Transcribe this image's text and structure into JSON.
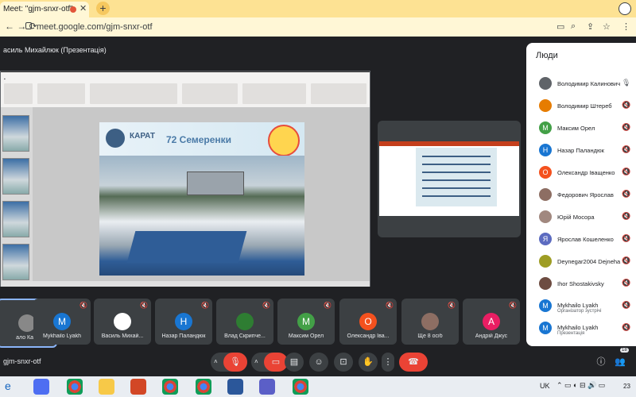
{
  "browser": {
    "tab_title": "Meet: \"gjm-snxr-otf\"",
    "close_glyph": "✕",
    "new_tab_glyph": "+",
    "url": "meet.google.com/gjm-snxr-otf",
    "nav_back": "←  →  ⟳"
  },
  "meet": {
    "presenter_label": "асиль Михайлюк (Презентація)",
    "meeting_code": "gjm-snxr-otf",
    "people_panel_title": "Люди",
    "accent": "#1a73e8",
    "hangup_color": "#ea4335"
  },
  "slide": {
    "logo_text": "КАРАТ",
    "title": "72 Семеренки"
  },
  "people": [
    {
      "name": "Володимир Калинович",
      "initial": "",
      "color": "#5f6368",
      "sub": "",
      "mic": "🎙"
    },
    {
      "name": "Володимир Штереб",
      "initial": "",
      "color": "#e67c00",
      "sub": "",
      "mic": "🔇"
    },
    {
      "name": "Максим Орел",
      "initial": "M",
      "color": "#43a047",
      "sub": "",
      "mic": "🔇"
    },
    {
      "name": "Назар Паландюк",
      "initial": "Н",
      "color": "#1976d2",
      "sub": "",
      "mic": "🔇"
    },
    {
      "name": "Олександр Іващенко",
      "initial": "О",
      "color": "#f4511e",
      "sub": "",
      "mic": "🔇"
    },
    {
      "name": "Федорович Ярослав",
      "initial": "",
      "color": "#8d6e63",
      "sub": "",
      "mic": "🔇"
    },
    {
      "name": "Юрій Мосора",
      "initial": "",
      "color": "#a1887f",
      "sub": "",
      "mic": "🔇"
    },
    {
      "name": "Ярослав Кошеленко",
      "initial": "Я",
      "color": "#5c6bc0",
      "sub": "",
      "mic": "🔇"
    },
    {
      "name": "Deynegar2004 Dejneha",
      "initial": "",
      "color": "#9e9d24",
      "sub": "",
      "mic": "🔇"
    },
    {
      "name": "Ihor Shostakivsky",
      "initial": "",
      "color": "#6d4c41",
      "sub": "",
      "mic": "🔇"
    },
    {
      "name": "Mykhailo Lyakh",
      "initial": "M",
      "color": "#1976d2",
      "sub": "Організатор зустрічі",
      "mic": "🔇"
    },
    {
      "name": "Mykhailo Lyakh",
      "initial": "M",
      "color": "#1976d2",
      "sub": "Презентація",
      "mic": "🔇"
    }
  ],
  "tiles": [
    {
      "name": "ало Ка...",
      "initial": "",
      "color": "#888888"
    },
    {
      "name": "Mykhailo Lyakh",
      "initial": "M",
      "color": "#1976d2"
    },
    {
      "name": "Василь Михай...",
      "initial": "",
      "color": "#ffffff"
    },
    {
      "name": "Назар Паландюк",
      "initial": "Н",
      "color": "#1976d2"
    },
    {
      "name": "Влад Скрипче...",
      "initial": "",
      "color": "#2e7d32"
    },
    {
      "name": "Максим Орел",
      "initial": "M",
      "color": "#43a047"
    },
    {
      "name": "Олександр Іва...",
      "initial": "О",
      "color": "#f4511e"
    },
    {
      "name": "Ще 8 осіб",
      "initial": "",
      "color": "#8d6e63"
    },
    {
      "name": "Андрій Джус",
      "initial": "А",
      "color": "#e91e63"
    }
  ],
  "controls": {
    "badge_count": "18"
  },
  "taskbar": {
    "lang": "UK",
    "time": "23"
  }
}
